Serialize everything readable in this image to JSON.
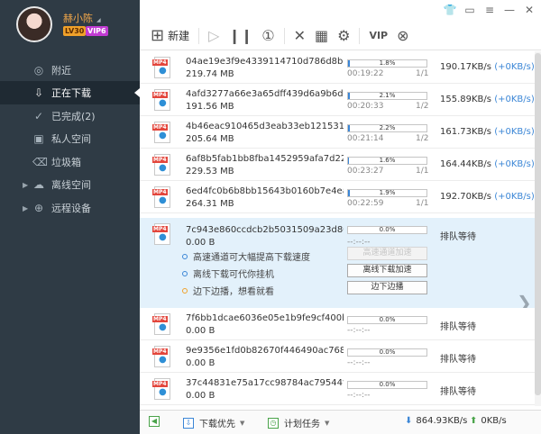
{
  "profile": {
    "username": "赫小陈",
    "level": "LV30",
    "vip": "VIP6"
  },
  "sidebar": {
    "items": [
      {
        "label": "附近",
        "icon": "location-icon"
      },
      {
        "label": "正在下载",
        "icon": "download-icon"
      },
      {
        "label": "已完成(2)",
        "icon": "check-circle-icon"
      },
      {
        "label": "私人空间",
        "icon": "lock-icon"
      },
      {
        "label": "垃圾箱",
        "icon": "trash-icon"
      },
      {
        "label": "离线空间",
        "icon": "cloud-icon"
      },
      {
        "label": "远程设备",
        "icon": "remote-device-icon"
      }
    ]
  },
  "toolbar": {
    "new_label": "新建"
  },
  "tasks": [
    {
      "name": "04ae19e3f9e4339114710d786d8b3c93...",
      "size": "219.74 MB",
      "percent": "1.8%",
      "time": "00:19:22",
      "blocks": "1/1",
      "speed": "190.17KB/s",
      "upspeed": "(+0KB/s)"
    },
    {
      "name": "4afd3277a66e3a65dff439d6a9b6d484...",
      "size": "191.56 MB",
      "percent": "2.1%",
      "time": "00:20:33",
      "blocks": "1/2",
      "speed": "155.89KB/s",
      "upspeed": "(+0KB/s)"
    },
    {
      "name": "4b46eac910465d3eab33eb121531f94b...",
      "size": "205.64 MB",
      "percent": "2.2%",
      "time": "00:21:14",
      "blocks": "1/2",
      "speed": "161.73KB/s",
      "upspeed": "(+0KB/s)"
    },
    {
      "name": "6af8b5fab1bb8fba1452959afa7d22c3.m...",
      "size": "229.53 MB",
      "percent": "1.6%",
      "time": "00:23:27",
      "blocks": "1/1",
      "speed": "164.44KB/s",
      "upspeed": "(+0KB/s)"
    },
    {
      "name": "6ed4fc0b6b8bb15643b0160b7e4ea208...",
      "size": "264.31 MB",
      "percent": "1.9%",
      "time": "00:22:59",
      "blocks": "1/1",
      "speed": "192.70KB/s",
      "upspeed": "(+0KB/s)"
    }
  ],
  "expanded_task": {
    "name": "7c943e860ccdcb2b5031509a23d80775...",
    "size": "0.00 B",
    "percent": "0.0%",
    "time": "--:--:--",
    "status": "排队等待",
    "tips": [
      {
        "text": "高速通道可大幅提高下载速度",
        "button": "高速通道加速"
      },
      {
        "text": "离线下载可代你挂机",
        "button": "离线下载加速"
      },
      {
        "text": "边下边播，想看就看",
        "button": "边下边播"
      }
    ]
  },
  "queued_tasks": [
    {
      "name": "7f6bb1dcae6036e05e1b9fe9cf400bbe.m...",
      "size": "0.00 B",
      "percent": "0.0%",
      "time": "--:--:--",
      "status": "排队等待"
    },
    {
      "name": "9e9356e1fd0b82670f446490ac76870d...",
      "size": "0.00 B",
      "percent": "0.0%",
      "time": "--:--:--",
      "status": "排队等待"
    },
    {
      "name": "37c44831e75a17cc98784ac79544f344...",
      "size": "0.00 B",
      "percent": "0.0%",
      "time": "--:--:--",
      "status": "排队等待"
    }
  ],
  "statusbar": {
    "priority": "下载优先",
    "schedule": "计划任务",
    "down_speed": "864.93KB/s",
    "up_speed": "0KB/s"
  },
  "colors": {
    "accent": "#3b86d6",
    "sidebar_bg": "#2f3b45",
    "expanded_bg": "#e3f1fb"
  }
}
